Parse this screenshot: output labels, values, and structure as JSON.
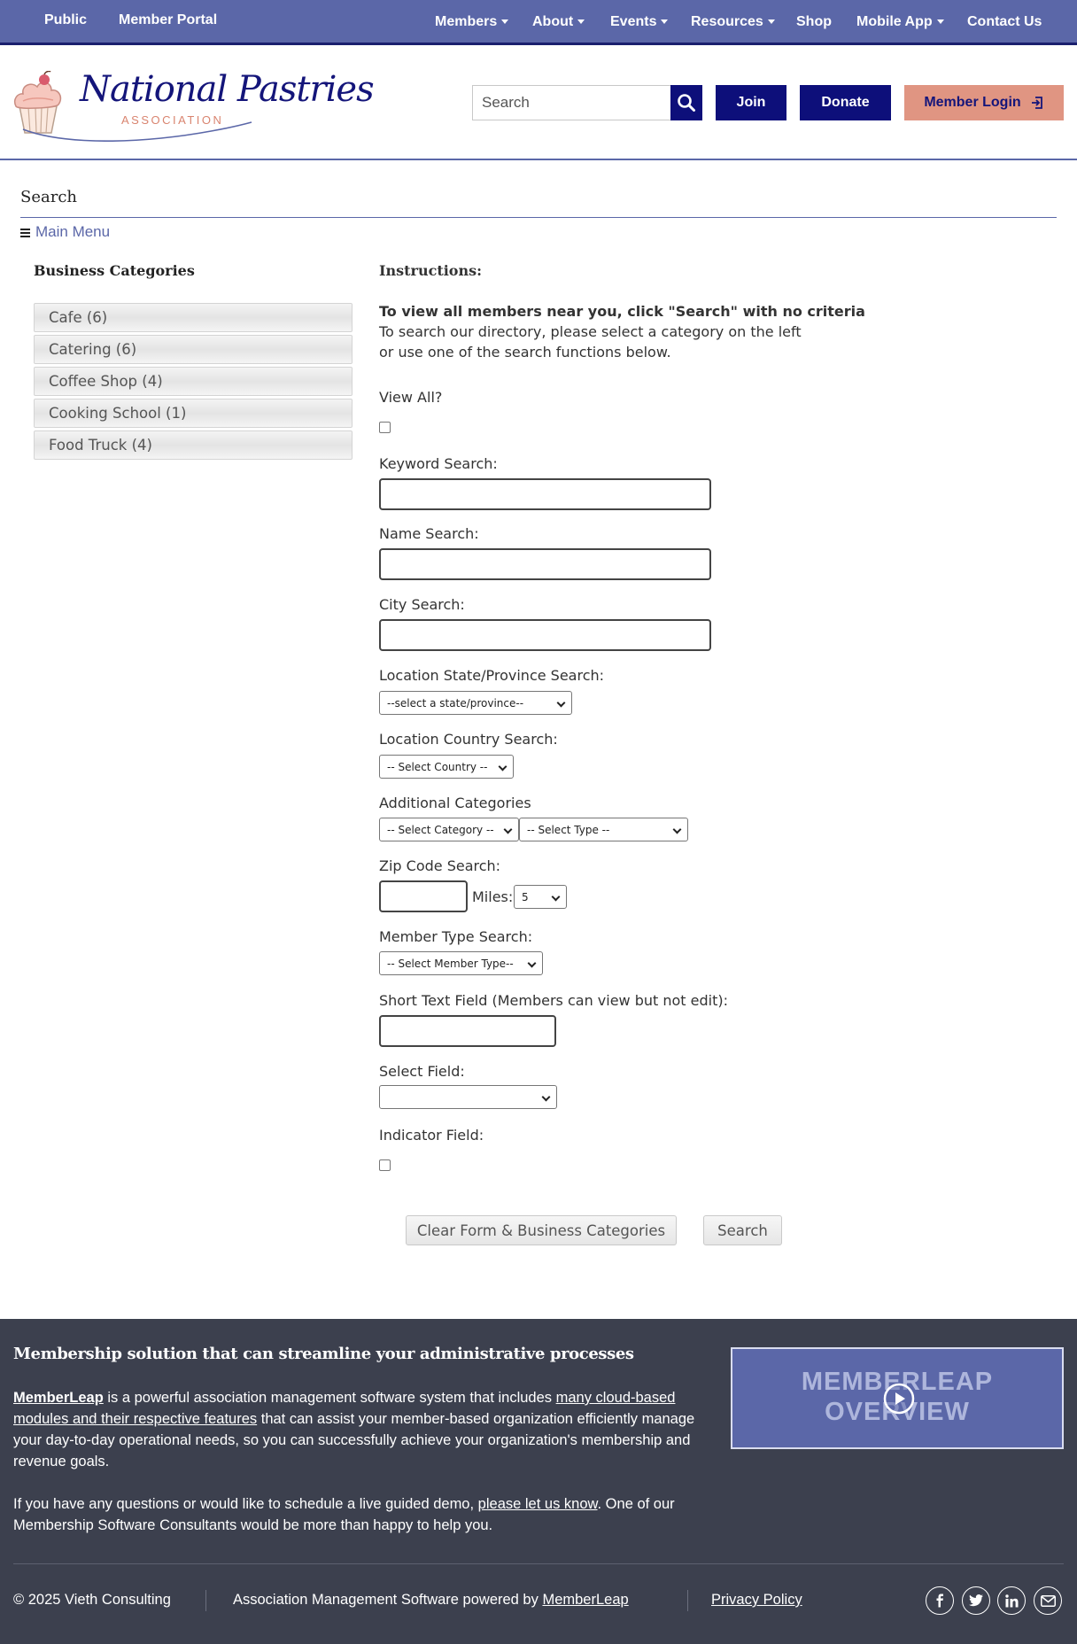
{
  "topnav": {
    "left": [
      "Public",
      "Member Portal"
    ],
    "items": [
      "Members",
      "About",
      "Events",
      "Resources",
      "Shop",
      "Mobile App",
      "Contact Us"
    ]
  },
  "header": {
    "logo_title": "National Pastries",
    "logo_subtitle": "ASSOCIATION",
    "search_placeholder": "Search",
    "join": "Join",
    "donate": "Donate",
    "member_login": "Member Login"
  },
  "page": {
    "title": "Search",
    "main_menu": "Main Menu"
  },
  "sidebar": {
    "heading": "Business Categories",
    "categories": [
      "Cafe (6)",
      "Catering (6)",
      "Coffee Shop (4)",
      "Cooking School (1)",
      "Food Truck (4)"
    ]
  },
  "form": {
    "instructions_heading": "Instructions:",
    "instructions_bold": "To view all members near you, click \"Search\" with no criteria",
    "instructions_line1": "To search our directory, please select a category on the left",
    "instructions_line2": "or use one of the search functions below.",
    "view_all": "View All?",
    "keyword": "Keyword Search:",
    "name": "Name Search:",
    "city": "City Search:",
    "state": "Location State/Province Search:",
    "state_select": "--select a state/province--",
    "country": "Location Country Search:",
    "country_select": "-- Select Country --",
    "additional": "Additional Categories",
    "category_select": "-- Select Category --",
    "type_select": "-- Select Type --",
    "zip": "Zip Code Search:",
    "miles": "Miles:",
    "miles_value": "5",
    "member_type": "Member Type Search:",
    "member_type_select": "-- Select Member Type--",
    "short_text": "Short Text Field (Members can view but not edit):",
    "select_field": "Select Field:",
    "indicator": "Indicator Field:",
    "clear_button": "Clear Form & Business Categories",
    "search_button": "Search"
  },
  "footer": {
    "heading": "Membership solution that can streamline your administrative processes",
    "p1_link1": "MemberLeap",
    "p1_text1": " is a powerful association management software system that includes ",
    "p1_link2": "many cloud-based modules and their respective features",
    "p1_text2": " that can assist your member-based organization efficiently manage your day-to-day operational needs, so you can successfully achieve your organization's membership and revenue goals.",
    "p2_text1": "If you have any questions or would like to schedule a live guided demo, ",
    "p2_link": "please let us know",
    "p2_text2": ". One of our Membership Software Consultants would be more than happy to help you.",
    "video_line1": "MEMBERLEAP",
    "video_line2": "OVERVIEW",
    "copyright": "© 2025 Vieth Consulting",
    "powered_text": "Association Management Software powered by ",
    "powered_link": "MemberLeap",
    "privacy": "Privacy Policy"
  },
  "colors": {
    "nav": "#5b67a8",
    "navy": "#0d0f7a",
    "salmon": "#e09582",
    "footer": "#3c404e"
  }
}
